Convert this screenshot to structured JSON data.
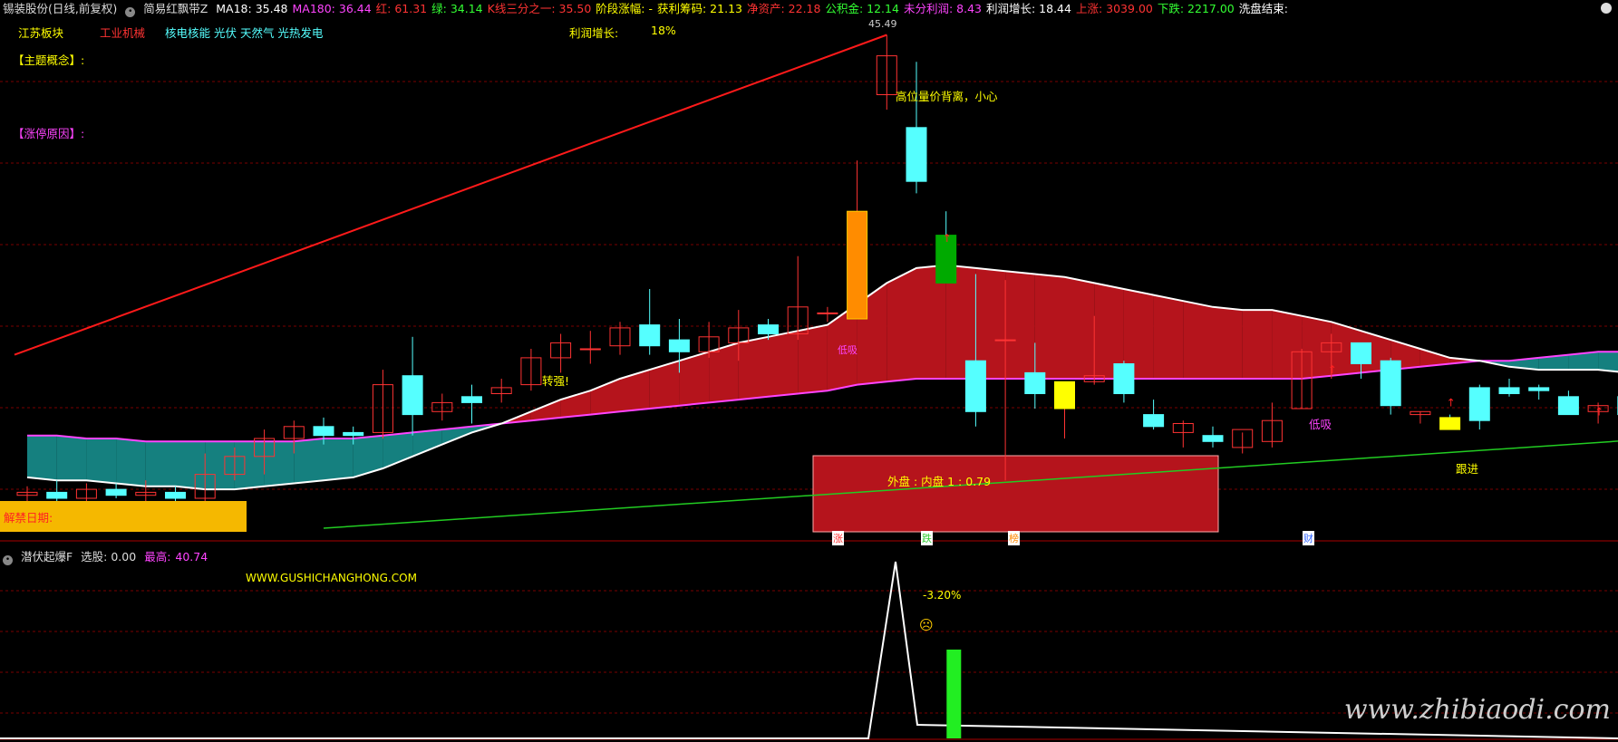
{
  "header": {
    "stock_name": "锡装股份(日线,前复权)",
    "indicator_name": "简易红飘带Z",
    "items": [
      {
        "label": "MA18: 35.48",
        "color": "#ffffff"
      },
      {
        "label": "MA180: 36.44",
        "color": "#ff44ff"
      },
      {
        "label": "红: 61.31",
        "color": "#ff3333"
      },
      {
        "label": "绿: 34.14",
        "color": "#33ff33"
      },
      {
        "label": "K线三分之一: 35.50",
        "color": "#ff3333"
      },
      {
        "label": "阶段涨幅: -",
        "color": "#ffff00"
      },
      {
        "label": "获利筹码: 21.13",
        "color": "#ffff00"
      },
      {
        "label": "净资产: 22.18",
        "color": "#ff3333"
      },
      {
        "label": "公积金: 12.14",
        "color": "#33ff33"
      },
      {
        "label": "未分利润: 8.43",
        "color": "#ff44ff"
      },
      {
        "label": "利润增长: 18.44",
        "color": "#ffffff"
      },
      {
        "label": "上涨: 3039.00",
        "color": "#ff3333"
      },
      {
        "label": "下跌: 2217.00",
        "color": "#33ff33"
      },
      {
        "label": "洗盘结束:",
        "color": "#ffffff"
      }
    ]
  },
  "sectors": [
    {
      "label": "江苏板块",
      "color": "#ffff00"
    },
    {
      "label": "工业机械",
      "color": "#ff3333"
    },
    {
      "label": "核电核能 光伏 天然气 光热发电",
      "color": "#55ffff"
    }
  ],
  "profit": {
    "label": "利润增长:",
    "value": "18%"
  },
  "concept_label": "【主题概念】:",
  "reason_label": "【涨停原因】:",
  "expire_label": "解禁日期:",
  "peak_price": "45.49",
  "annotations": {
    "warning": "高位量价背离，小心",
    "turn_strong": "转强!",
    "low_absorb_1": "低吸",
    "low_absorb_2": "低吸",
    "follow": "跟进",
    "ratio": "外盘 : 内盘   1  :  0.79"
  },
  "tags": {
    "rise": "涨",
    "fall": "跌",
    "list": "榜",
    "finance": "财"
  },
  "sub": {
    "name": "潜伏起爆F",
    "select_label": "选股: 0.00",
    "high_label": "最高:",
    "high_value": "40.74",
    "website": "WWW.GUSHICHANGHONG.COM",
    "pct": "-3.20%"
  },
  "watermark": "www.zhibiaodi.com",
  "colors": {
    "up": "#ff3333",
    "down": "#55ffff",
    "ribbon_red": "#b5141c",
    "ribbon_teal": "#15807f",
    "ma_long": "#ff44ff",
    "ma_short": "#ffffff",
    "grid": "#7a0000"
  },
  "chart_data": {
    "type": "candlestick",
    "y_range": [
      29,
      46
    ],
    "candles": [
      {
        "o": 30.1,
        "h": 30.4,
        "l": 29.8,
        "c": 30.2
      },
      {
        "o": 30.2,
        "h": 30.6,
        "l": 29.9,
        "c": 30.0
      },
      {
        "o": 30.0,
        "h": 30.5,
        "l": 29.8,
        "c": 30.3
      },
      {
        "o": 30.3,
        "h": 30.5,
        "l": 30.0,
        "c": 30.1
      },
      {
        "o": 30.1,
        "h": 30.6,
        "l": 29.9,
        "c": 30.2
      },
      {
        "o": 30.2,
        "h": 30.4,
        "l": 29.9,
        "c": 30.0
      },
      {
        "o": 30.0,
        "h": 31.5,
        "l": 29.9,
        "c": 30.8
      },
      {
        "o": 30.8,
        "h": 31.7,
        "l": 30.6,
        "c": 31.4
      },
      {
        "o": 31.4,
        "h": 32.3,
        "l": 30.8,
        "c": 32.0
      },
      {
        "o": 32.0,
        "h": 32.6,
        "l": 31.5,
        "c": 32.4
      },
      {
        "o": 32.4,
        "h": 32.7,
        "l": 31.8,
        "c": 32.1
      },
      {
        "o": 32.2,
        "h": 32.4,
        "l": 31.8,
        "c": 32.1
      },
      {
        "o": 32.2,
        "h": 34.3,
        "l": 32.0,
        "c": 33.8
      },
      {
        "o": 34.1,
        "h": 35.4,
        "l": 32.1,
        "c": 32.8
      },
      {
        "o": 32.9,
        "h": 33.5,
        "l": 32.6,
        "c": 33.2
      },
      {
        "o": 33.4,
        "h": 33.8,
        "l": 32.5,
        "c": 33.2
      },
      {
        "o": 33.5,
        "h": 34.0,
        "l": 33.2,
        "c": 33.7
      },
      {
        "o": 33.8,
        "h": 35.0,
        "l": 33.6,
        "c": 34.7
      },
      {
        "o": 34.7,
        "h": 35.5,
        "l": 34.2,
        "c": 35.2
      },
      {
        "o": 35.0,
        "h": 35.6,
        "l": 34.5,
        "c": 35.0
      },
      {
        "o": 35.1,
        "h": 35.9,
        "l": 34.8,
        "c": 35.7
      },
      {
        "o": 35.8,
        "h": 37.0,
        "l": 34.8,
        "c": 35.1
      },
      {
        "o": 35.3,
        "h": 36.0,
        "l": 34.2,
        "c": 34.9
      },
      {
        "o": 34.9,
        "h": 35.9,
        "l": 34.7,
        "c": 35.4
      },
      {
        "o": 35.2,
        "h": 36.3,
        "l": 34.6,
        "c": 35.7
      },
      {
        "o": 35.8,
        "h": 36.0,
        "l": 35.3,
        "c": 35.5
      },
      {
        "o": 35.5,
        "h": 38.1,
        "l": 35.3,
        "c": 36.4
      },
      {
        "o": 36.2,
        "h": 36.4,
        "l": 35.9,
        "c": 36.2
      },
      {
        "o": 36.0,
        "h": 41.3,
        "l": 36.0,
        "c": 39.6
      },
      {
        "o": 43.5,
        "h": 45.5,
        "l": 43.0,
        "c": 44.8
      },
      {
        "o": 42.4,
        "h": 44.6,
        "l": 40.2,
        "c": 40.6
      },
      {
        "o": 38.8,
        "h": 39.6,
        "l": 37.5,
        "c": 37.2
      },
      {
        "o": 34.6,
        "h": 37.5,
        "l": 32.4,
        "c": 32.9
      },
      {
        "o": 35.3,
        "h": 37.3,
        "l": 30.6,
        "c": 35.3
      },
      {
        "o": 34.2,
        "h": 35.2,
        "l": 33.0,
        "c": 33.5
      },
      {
        "o": 33.0,
        "h": 33.8,
        "l": 32.0,
        "c": 33.9
      },
      {
        "o": 33.9,
        "h": 36.1,
        "l": 33.8,
        "c": 34.1
      },
      {
        "o": 34.5,
        "h": 34.6,
        "l": 33.2,
        "c": 33.5
      },
      {
        "o": 32.8,
        "h": 33.3,
        "l": 32.3,
        "c": 32.4
      },
      {
        "o": 32.2,
        "h": 32.6,
        "l": 31.7,
        "c": 32.5
      },
      {
        "o": 32.1,
        "h": 32.4,
        "l": 31.7,
        "c": 31.9
      },
      {
        "o": 31.7,
        "h": 32.2,
        "l": 31.5,
        "c": 32.3
      },
      {
        "o": 31.9,
        "h": 33.2,
        "l": 31.7,
        "c": 32.6
      },
      {
        "o": 33.0,
        "h": 35.0,
        "l": 33.0,
        "c": 34.9
      },
      {
        "o": 34.9,
        "h": 35.5,
        "l": 34.0,
        "c": 35.2
      },
      {
        "o": 35.2,
        "h": 35.1,
        "l": 34.0,
        "c": 34.5
      },
      {
        "o": 34.6,
        "h": 34.7,
        "l": 32.8,
        "c": 33.1
      },
      {
        "o": 32.8,
        "h": 32.9,
        "l": 32.5,
        "c": 32.9
      },
      {
        "o": 32.7,
        "h": 32.8,
        "l": 32.3,
        "c": 32.3
      },
      {
        "o": 33.7,
        "h": 33.8,
        "l": 32.3,
        "c": 32.6
      },
      {
        "o": 33.7,
        "h": 34.0,
        "l": 33.4,
        "c": 33.5
      },
      {
        "o": 33.7,
        "h": 33.8,
        "l": 33.3,
        "c": 33.6
      },
      {
        "o": 33.4,
        "h": 33.6,
        "l": 32.8,
        "c": 32.8
      },
      {
        "o": 32.9,
        "h": 33.2,
        "l": 32.5,
        "c": 33.1
      },
      {
        "o": 33.4,
        "h": 33.5,
        "l": 32.9,
        "c": 32.8
      }
    ],
    "ma_long": [
      32.1,
      32.1,
      32.0,
      32.0,
      31.9,
      31.9,
      31.9,
      31.9,
      31.9,
      31.9,
      32.0,
      32.0,
      32.1,
      32.2,
      32.3,
      32.4,
      32.5,
      32.6,
      32.7,
      32.8,
      32.9,
      33.0,
      33.1,
      33.2,
      33.3,
      33.4,
      33.5,
      33.6,
      33.8,
      33.9,
      34.0,
      34.0,
      34.0,
      34.0,
      34.0,
      34.0,
      34.0,
      34.0,
      34.0,
      34.0,
      34.0,
      34.0,
      34.0,
      34.0,
      34.1,
      34.2,
      34.3,
      34.4,
      34.5,
      34.6,
      34.6,
      34.7,
      34.8,
      34.9,
      34.9
    ],
    "ma_short": [
      30.7,
      30.6,
      30.6,
      30.5,
      30.4,
      30.4,
      30.3,
      30.3,
      30.4,
      30.5,
      30.6,
      30.7,
      31.0,
      31.4,
      31.8,
      32.2,
      32.5,
      32.9,
      33.3,
      33.6,
      34.0,
      34.3,
      34.6,
      34.9,
      35.2,
      35.4,
      35.6,
      35.8,
      36.5,
      37.2,
      37.7,
      37.8,
      37.7,
      37.6,
      37.5,
      37.4,
      37.2,
      37.0,
      36.8,
      36.6,
      36.4,
      36.3,
      36.3,
      36.1,
      35.9,
      35.6,
      35.3,
      35.0,
      34.7,
      34.6,
      34.4,
      34.3,
      34.3,
      34.3,
      34.2
    ],
    "trend_red": {
      "from": [
        0,
        34.8
      ],
      "to": [
        29,
        45.5
      ]
    },
    "trend_green": {
      "from": [
        10,
        29.0
      ],
      "to": [
        55,
        32.0
      ]
    },
    "sub_peak_index": 29,
    "sub_bar_value": 40.74
  }
}
